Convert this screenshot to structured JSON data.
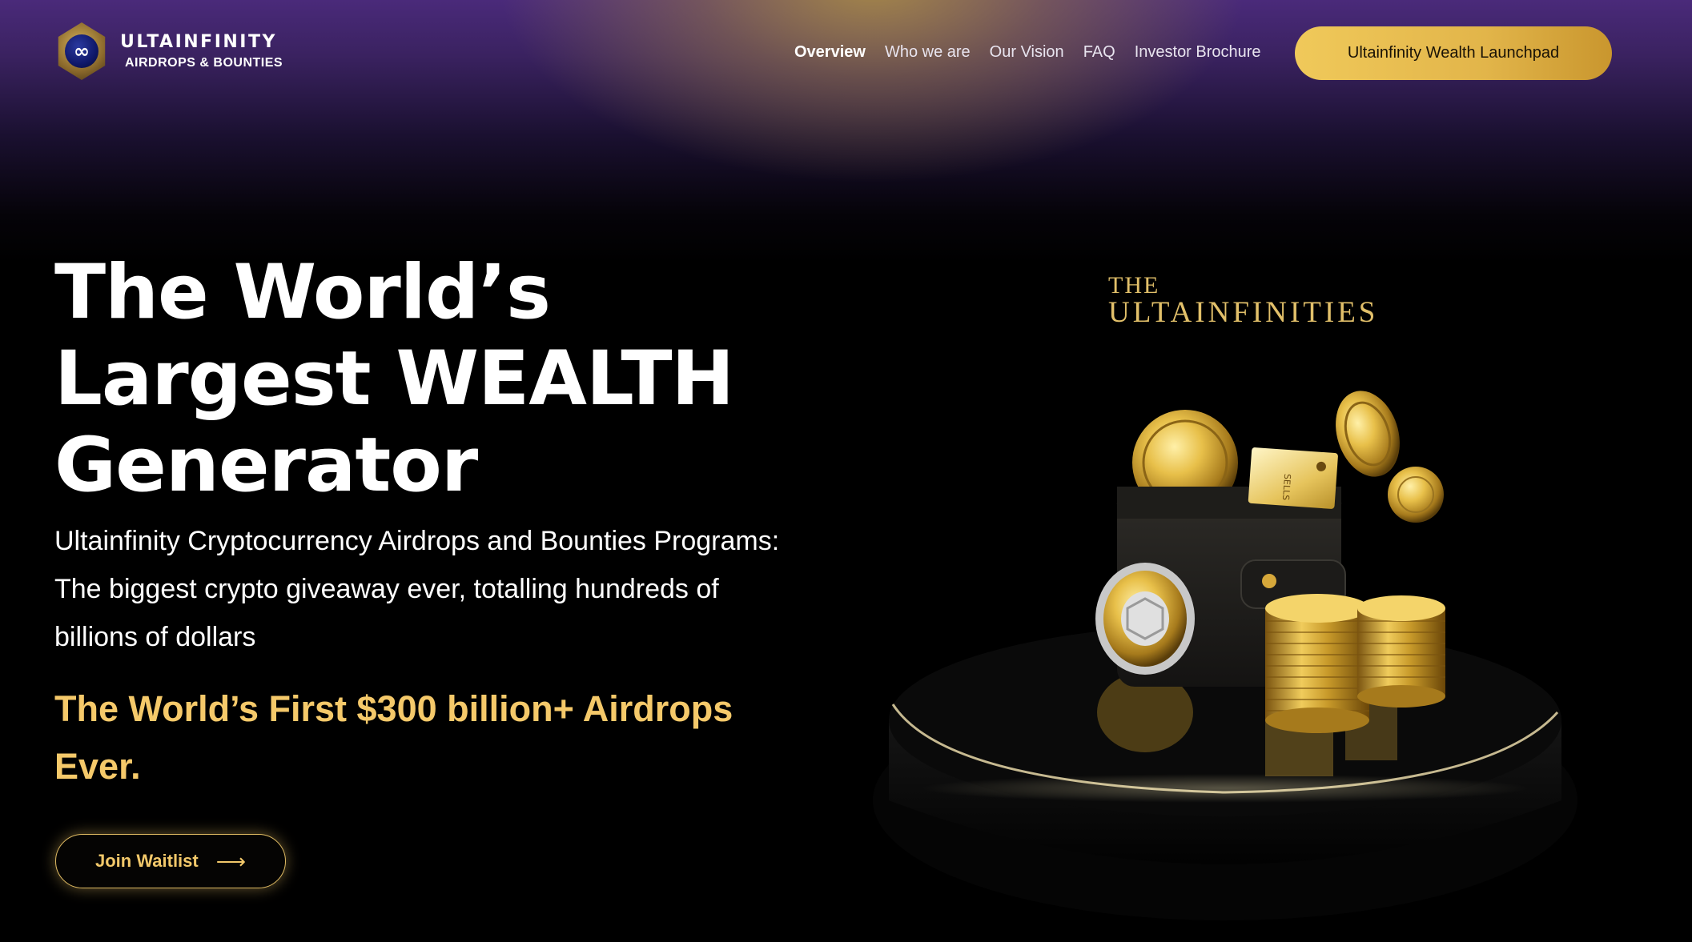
{
  "header": {
    "logo_title": "ULTAINFINITY",
    "logo_subtitle": "AIRDROPS & BOUNTIES",
    "logo_symbol": "∞",
    "nav": [
      {
        "label": "Overview",
        "active": true
      },
      {
        "label": "Who we are",
        "active": false
      },
      {
        "label": "Our Vision",
        "active": false
      },
      {
        "label": "FAQ",
        "active": false
      },
      {
        "label": "Investor Brochure",
        "active": false
      }
    ],
    "cta_label": "Ultainfinity Wealth Launchpad"
  },
  "hero": {
    "title_lines": [
      "The World’s",
      "Largest WEALTH",
      "Generator"
    ],
    "description": "Ultainfinity Cryptocurrency Airdrops and Bounties Programs: The biggest crypto giveaway ever, totalling hundreds of billions of dollars",
    "accent": "The World’s First $300 billion+ Airdrops Ever.",
    "join_label": "Join Waitlist",
    "join_icon": "arrow-right-icon",
    "join_arrow": "⟶"
  },
  "art": {
    "brand_the": "THE",
    "brand_name": "ULTAINFINITIES",
    "card_text": "SELLS"
  },
  "colors": {
    "gold_accent": "#f5c96a",
    "cta_gold": "#e2b54a",
    "background": "#000000",
    "header_purple": "#4a2a7a"
  }
}
